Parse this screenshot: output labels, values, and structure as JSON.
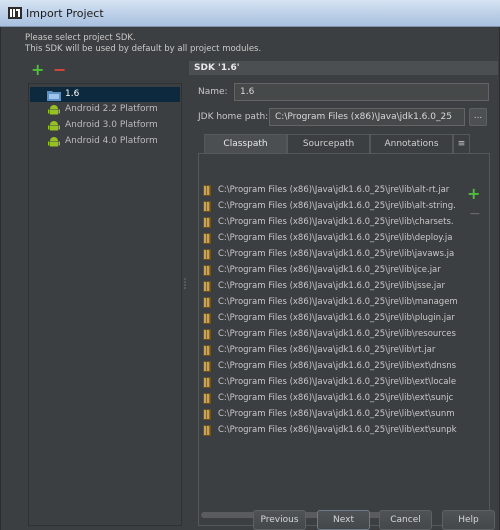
{
  "window": {
    "title": "Import Project"
  },
  "message": {
    "line1": "Please select project SDK.",
    "line2": "This SDK will be used by default by all project modules."
  },
  "toolbar": {
    "add_glyph": "+",
    "remove_glyph": "−"
  },
  "sdk_list": [
    {
      "label": "1.6",
      "icon": "jdk-folder-icon",
      "selected": true
    },
    {
      "label": "Android 2.2 Platform",
      "icon": "android-icon",
      "selected": false
    },
    {
      "label": "Android 3.0 Platform",
      "icon": "android-icon",
      "selected": false
    },
    {
      "label": "Android 4.0 Platform",
      "icon": "android-icon",
      "selected": false
    }
  ],
  "detail": {
    "header": "SDK '1.6'",
    "name_label": "Name:",
    "name_value": "1.6",
    "jdk_label": "JDK home path:",
    "jdk_value": "C:\\Program Files (x86)\\Java\\jdk1.6.0_25",
    "browse_label": "..."
  },
  "tabs": [
    {
      "label": "Classpath",
      "active": true
    },
    {
      "label": "Sourcepath",
      "active": false
    },
    {
      "label": "Annotations",
      "active": false
    }
  ],
  "tab_more": "≡",
  "classpath": [
    "C:\\Program Files (x86)\\Java\\jdk1.6.0_25\\jre\\lib\\alt-rt.jar",
    "C:\\Program Files (x86)\\Java\\jdk1.6.0_25\\jre\\lib\\alt-string.",
    "C:\\Program Files (x86)\\Java\\jdk1.6.0_25\\jre\\lib\\charsets.",
    "C:\\Program Files (x86)\\Java\\jdk1.6.0_25\\jre\\lib\\deploy.ja",
    "C:\\Program Files (x86)\\Java\\jdk1.6.0_25\\jre\\lib\\javaws.ja",
    "C:\\Program Files (x86)\\Java\\jdk1.6.0_25\\jre\\lib\\jce.jar",
    "C:\\Program Files (x86)\\Java\\jdk1.6.0_25\\jre\\lib\\jsse.jar",
    "C:\\Program Files (x86)\\Java\\jdk1.6.0_25\\jre\\lib\\managem",
    "C:\\Program Files (x86)\\Java\\jdk1.6.0_25\\jre\\lib\\plugin.jar",
    "C:\\Program Files (x86)\\Java\\jdk1.6.0_25\\jre\\lib\\resources",
    "C:\\Program Files (x86)\\Java\\jdk1.6.0_25\\jre\\lib\\rt.jar",
    "C:\\Program Files (x86)\\Java\\jdk1.6.0_25\\jre\\lib\\ext\\dnsns",
    "C:\\Program Files (x86)\\Java\\jdk1.6.0_25\\jre\\lib\\ext\\locale",
    "C:\\Program Files (x86)\\Java\\jdk1.6.0_25\\jre\\lib\\ext\\sunjc",
    "C:\\Program Files (x86)\\Java\\jdk1.6.0_25\\jre\\lib\\ext\\sunm",
    "C:\\Program Files (x86)\\Java\\jdk1.6.0_25\\jre\\lib\\ext\\sunpk"
  ],
  "buttons": {
    "previous": "Previous",
    "next": "Next",
    "cancel": "Cancel",
    "help": "Help"
  },
  "colors": {
    "background": "#3c3f41",
    "selection": "#0d293e",
    "add_green": "#4fbe3a",
    "remove_red": "#e0443a"
  }
}
